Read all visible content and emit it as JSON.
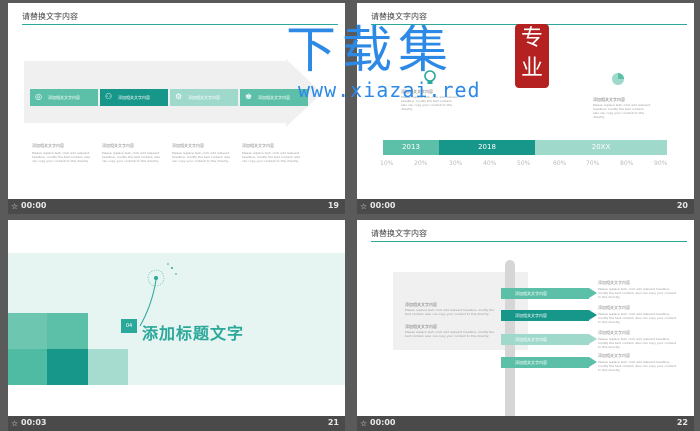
{
  "colors": {
    "teal": "#2aa89a",
    "teal_dark": "#17968a",
    "teal_mid": "#5cc0a8",
    "teal_light": "#9fd9cc",
    "watermark_blue": "#2d89e6",
    "seal_red": "#b52020"
  },
  "slides": [
    {
      "num": "19",
      "time": "00:00",
      "title": "请替换文字内容",
      "chips": [
        {
          "icon": "lightbulb-icon",
          "glyph": "◎",
          "label": "添加相关文字内容"
        },
        {
          "icon": "group-icon",
          "glyph": "⚇",
          "label": "添加相关文字内容"
        },
        {
          "icon": "settings-icon",
          "glyph": "⚙",
          "label": "添加相关文字内容"
        },
        {
          "icon": "trophy-icon",
          "glyph": "♚",
          "label": "添加相关文字内容"
        }
      ],
      "descs": [
        {
          "heading": "添加相关文字内容",
          "body": "Please replace text, click add relevant headline, modify the text content, also can copy your content to this directly."
        },
        {
          "heading": "添加相关文字内容",
          "body": "Please replace text, click add relevant headline, modify the text content, also can copy your content to this directly."
        },
        {
          "heading": "添加相关文字内容",
          "body": "Please replace text, click add relevant headline, modify the text content, also can copy your content to this directly."
        },
        {
          "heading": "添加相关文字内容",
          "body": "Please replace text, click add relevant headline, modify the text content, also can copy your content to this directly."
        }
      ]
    },
    {
      "num": "20",
      "time": "00:00",
      "title": "请替换文字内容",
      "left_heading": "添加相关文字内容",
      "left_body": "Please replace text, click add relevant headline, modify the text content, also can copy your content to this directly.",
      "right_heading": "添加相关文字内容",
      "right_body": "Please replace text, click add relevant headline, modify the text content, also can copy your content to this directly.",
      "years": [
        "2013",
        "2018",
        "20XX"
      ],
      "percents": [
        "10%",
        "20%",
        "30%",
        "40%",
        "50%",
        "60%",
        "70%",
        "80%",
        "90%"
      ]
    },
    {
      "num": "21",
      "time": "00:03",
      "badge": "04",
      "title": "添加标题文字"
    },
    {
      "num": "22",
      "time": "00:00",
      "title": "请替换文字内容",
      "box_heading1": "添加相关文字内容",
      "box_body1": "Please replace text, click add relevant headline, modify the text content, also can copy your content to this directly.",
      "box_heading2": "添加相关文字内容",
      "box_body2": "Please replace text, click add relevant headline, modify the text content, also can copy your content to this directly.",
      "tags": [
        "添加相关文字内容",
        "添加相关文字内容",
        "添加相关文字内容",
        "添加相关文字内容"
      ],
      "right": [
        {
          "heading": "添加相关文字内容",
          "body": "Please replace text, click add relevant headline, modify the text content, also can copy your content to this directly."
        },
        {
          "heading": "添加相关文字内容",
          "body": "Please replace text, click add relevant headline, modify the text content, also can copy your content to this directly."
        },
        {
          "heading": "添加相关文字内容",
          "body": "Please replace text, click add relevant headline, modify the text content, also can copy your content to this directly."
        },
        {
          "heading": "添加相关文字内容",
          "body": "Please replace text, click add relevant headline, modify the text content, also can copy your content to this directly."
        }
      ]
    }
  ],
  "watermark": {
    "big": "下载集",
    "seal": "专业",
    "url": "www.xiazai.red"
  }
}
